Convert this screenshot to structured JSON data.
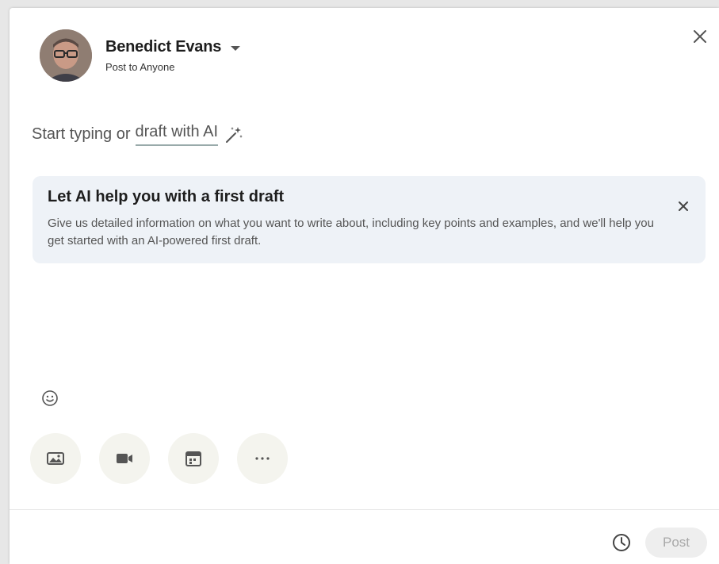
{
  "author": {
    "name": "Benedict Evans",
    "audience": "Post to Anyone"
  },
  "composer": {
    "prompt_prefix": "Start typing or",
    "draft_link": "draft with AI"
  },
  "ai_card": {
    "title": "Let AI help you with a first draft",
    "description": "Give us detailed information on what you want to write about, including key points and examples, and we'll help you get started with an AI-powered first draft."
  },
  "toolbar": {
    "items": [
      {
        "icon": "image-icon"
      },
      {
        "icon": "video-icon"
      },
      {
        "icon": "calendar-icon"
      },
      {
        "icon": "more-icon"
      }
    ]
  },
  "footer": {
    "post_label": "Post"
  },
  "colors": {
    "card_bg": "#eef2f7",
    "tool_bg": "#f4f4ee",
    "post_disabled_bg": "#eeeeee",
    "post_disabled_text": "#a8a8a8"
  }
}
